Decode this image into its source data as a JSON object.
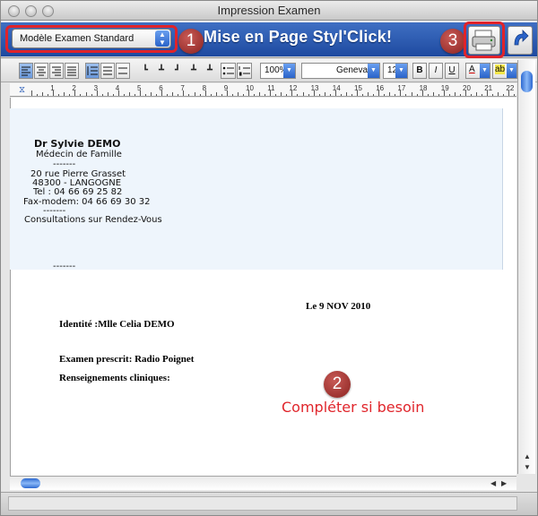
{
  "window": {
    "title": "Impression Examen"
  },
  "header": {
    "band_title": "Mise en Page Styl'Click!",
    "model_select": {
      "value": "Modèle Examen Standard"
    },
    "callouts": [
      "1",
      "2",
      "3"
    ]
  },
  "toolbar": {
    "zoom": "100%",
    "font": "Geneva",
    "size": "12",
    "bold": "B",
    "italic": "I",
    "underline": "U",
    "text_color_label": "A",
    "highlight_label": "ab"
  },
  "ruler": {
    "numbers": [
      "1",
      "2",
      "3",
      "4",
      "5",
      "6",
      "7",
      "8",
      "9",
      "10",
      "11",
      "12",
      "13",
      "14",
      "15",
      "16",
      "17",
      "18",
      "19",
      "20",
      "21",
      "22"
    ]
  },
  "letterhead": {
    "name": "Dr Sylvie DEMO",
    "specialty": "Médecin de Famille",
    "sep1": "-------",
    "address1": "20 rue Pierre Grasset",
    "address2": "48300 - LANGOGNE",
    "phone": "Tel : 04 66 69 25 82",
    "fax": "Fax-modem: 04 66 69 30 32",
    "sep2": "-------",
    "hours": "Consultations sur Rendez-Vous",
    "sep3": "-------"
  },
  "document": {
    "date": "Le 9 NOV 2010",
    "identity": "Identité :Mlle Celia DEMO",
    "exam": "Examen prescrit: Radio Poignet",
    "clinical": "Renseignements cliniques:",
    "annotation": "Compléter si besoin"
  },
  "colors": {
    "accent_blue": "#2a5db8",
    "callout_red": "#e0232a"
  }
}
